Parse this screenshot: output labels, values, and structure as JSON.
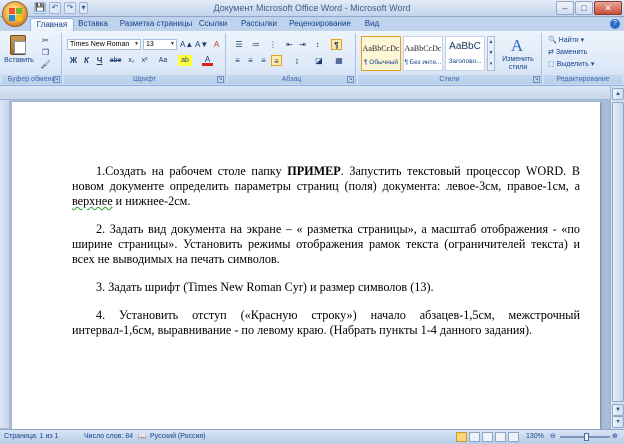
{
  "window": {
    "title": "Документ Microsoft Office Word - Microsoft Word"
  },
  "quick_access": {
    "save": "💾",
    "undo": "↶",
    "redo": "↷",
    "more": "▾"
  },
  "window_controls": {
    "minimize": "–",
    "maximize": "□",
    "close": "✕"
  },
  "tabs": [
    "Главная",
    "Вставка",
    "Разметка страницы",
    "Ссылки",
    "Рассылки",
    "Рецензирование",
    "Вид"
  ],
  "ribbon": {
    "clipboard": {
      "label": "Буфер обмена",
      "paste": "Вставить"
    },
    "font": {
      "label": "Шрифт",
      "font_name": "Times New Roman",
      "font_size": "13",
      "bold": "Ж",
      "italic": "К",
      "underline": "Ч",
      "strike": "abe",
      "subscript": "x₂",
      "superscript": "x²",
      "case": "Aa",
      "grow": "A▲",
      "shrink": "A▼",
      "clear": "A",
      "highlight": "ab",
      "color": "A"
    },
    "paragraph": {
      "label": "Абзац",
      "pilcrow": "¶"
    },
    "styles": {
      "label": "Стили",
      "items": [
        {
          "sample": "AaBbCcDc",
          "name": "¶ Обычный"
        },
        {
          "sample": "AaBbCcDc",
          "name": "¶ Без инте..."
        },
        {
          "sample": "AaBbC",
          "name": "Заголово..."
        }
      ],
      "change_label": "Изменить стили"
    },
    "editing": {
      "label": "Редактирование",
      "find": "Найти",
      "replace": "Заменить",
      "select": "Выделить"
    }
  },
  "document": {
    "p1_before": "1.Создать на рабочем столе папку ",
    "p1_bold": "ПРИМЕР",
    "p1_mid": ". Запустить текстовый процессор WORD. В новом документе определить параметры страниц (поля) документа: левое-3см, правое-1см, а ",
    "p1_squiggle": "верхнее",
    "p1_after": " и нижнее-2см.",
    "p2": "2. Задать вид документа на экране – « разметка страницы», а масштаб отображения - «по ширине страницы». Установить режимы отображения рамок текста (ограничителей текста) и всех не выводимых на печать символов.",
    "p3": "3. Задать шрифт (Times New Roman Cyr) и размер символов (13).",
    "p4": "4. Установить отступ («Красную строку») начало абзацев-1,5см, межстрочный интервал-1,6см, выравнивание - по левому краю. (Набрать пункты 1-4 данного задания)."
  },
  "statusbar": {
    "page": "Страница: 1 из 1",
    "words": "Число слов: 84",
    "language": "Русский (Россия)",
    "zoom": "130%",
    "zoom_level_percent": 130
  },
  "colors": {
    "accent": "#15428b",
    "ribbon_bg": "#dce8f7",
    "workspace": "#a9bcd6",
    "style_selected": "#e3a21a"
  }
}
